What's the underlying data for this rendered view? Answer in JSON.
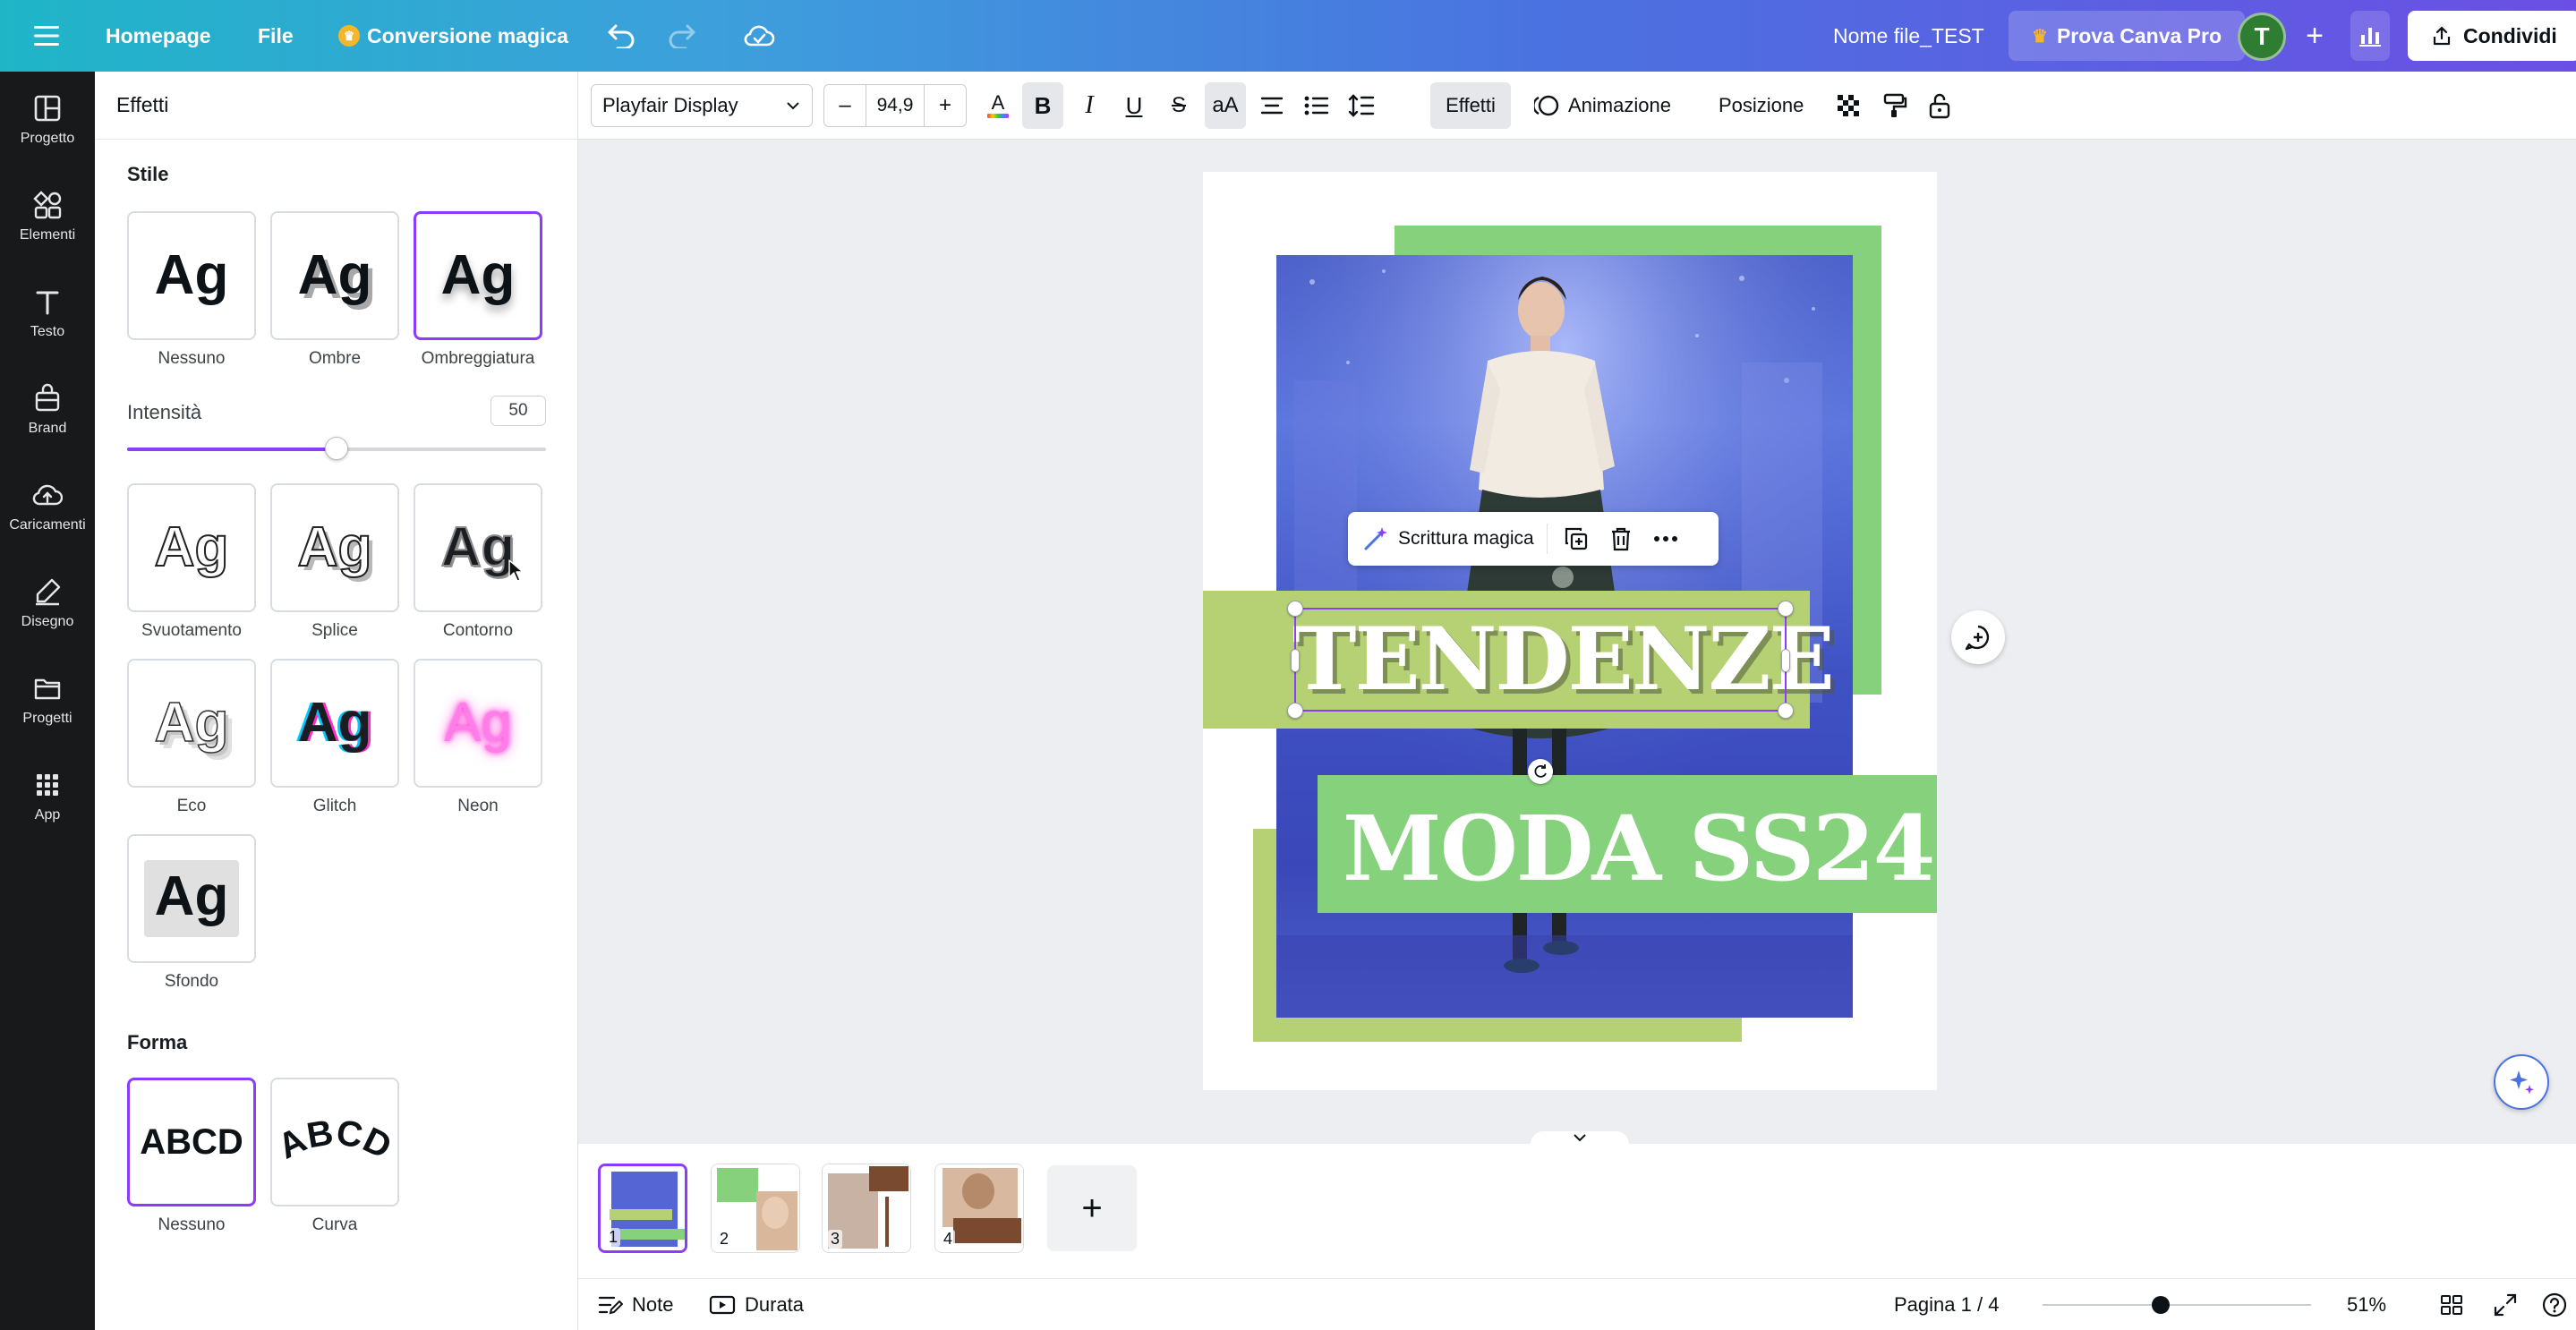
{
  "topbar": {
    "home": "Homepage",
    "file": "File",
    "magic_switch": "Conversione magica",
    "filename": "Nome file_TEST",
    "pro": "Prova Canva Pro",
    "avatar_initial": "T",
    "share": "Condividi"
  },
  "rail": {
    "items": [
      {
        "label": "Progetto",
        "icon": "layout-icon"
      },
      {
        "label": "Elementi",
        "icon": "shapes-icon"
      },
      {
        "label": "Testo",
        "icon": "text-icon"
      },
      {
        "label": "Brand",
        "icon": "brand-icon"
      },
      {
        "label": "Caricamenti",
        "icon": "cloud-upload-icon"
      },
      {
        "label": "Disegno",
        "icon": "pen-icon"
      },
      {
        "label": "Progetti",
        "icon": "folder-icon"
      },
      {
        "label": "App",
        "icon": "apps-grid-icon"
      }
    ]
  },
  "panel": {
    "title": "Effetti",
    "style_title": "Stile",
    "shape_title": "Forma",
    "sample": "Ag",
    "shape_sample": "ABCD",
    "intensity_label": "Intensità",
    "intensity_value": "50",
    "intensity_fraction": 0.5,
    "styles": [
      "Nessuno",
      "Ombre",
      "Ombreggiatura",
      "Svuotamento",
      "Splice",
      "Contorno",
      "Eco",
      "Glitch",
      "Neon",
      "Sfondo"
    ],
    "selected_style": "Ombreggiatura",
    "shapes": [
      "Nessuno",
      "Curva"
    ],
    "selected_shape": "Nessuno",
    "accent": "#8b3dff"
  },
  "toolbar": {
    "font": "Playfair Display",
    "size_minus": "–",
    "size": "94,9",
    "size_plus": "+",
    "effects": "Effetti",
    "animation": "Animazione",
    "position": "Posizione"
  },
  "canvas": {
    "heading": "TENDENZE",
    "subheading": "MODA SS24",
    "context_menu": {
      "magic_write": "Scrittura magica"
    },
    "colors": {
      "green": "#86d17c",
      "yellow_green": "#b6d174",
      "selection": "#8b3dff"
    }
  },
  "pages": {
    "thumbs": [
      "1",
      "2",
      "3",
      "4"
    ],
    "add": "+"
  },
  "bottombar": {
    "notes": "Note",
    "duration": "Durata",
    "page_indicator": "Pagina 1 / 4",
    "zoom": "51%",
    "zoom_fraction": 0.51
  }
}
